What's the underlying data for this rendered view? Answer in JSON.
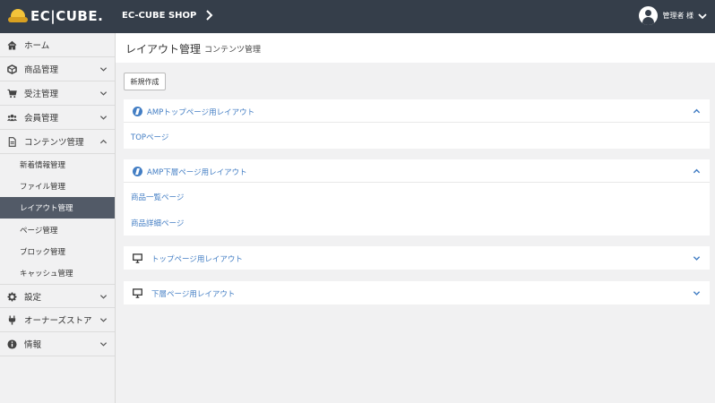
{
  "header": {
    "logo_text": "EC|CUBE.",
    "shop_name": "EC-CUBE SHOP",
    "user_name": "管理者 様"
  },
  "sidebar": {
    "items": [
      {
        "label": "ホーム",
        "icon": "home-icon",
        "expandable": false
      },
      {
        "label": "商品管理",
        "icon": "cube-icon",
        "expandable": true,
        "expanded": false
      },
      {
        "label": "受注管理",
        "icon": "cart-icon",
        "expandable": true,
        "expanded": false
      },
      {
        "label": "会員管理",
        "icon": "users-icon",
        "expandable": true,
        "expanded": false
      },
      {
        "label": "コンテンツ管理",
        "icon": "file-icon",
        "expandable": true,
        "expanded": true
      },
      {
        "label": "設定",
        "icon": "gear-icon",
        "expandable": true,
        "expanded": false
      },
      {
        "label": "オーナーズストア",
        "icon": "plug-icon",
        "expandable": true,
        "expanded": false
      },
      {
        "label": "情報",
        "icon": "info-icon",
        "expandable": true,
        "expanded": false
      }
    ],
    "content_sub_items": [
      {
        "label": "新着情報管理",
        "active": false
      },
      {
        "label": "ファイル管理",
        "active": false
      },
      {
        "label": "レイアウト管理",
        "active": true
      },
      {
        "label": "ページ管理",
        "active": false
      },
      {
        "label": "ブロック管理",
        "active": false
      },
      {
        "label": "キャッシュ管理",
        "active": false
      }
    ]
  },
  "page": {
    "title": "レイアウト管理",
    "subtitle": "コンテンツ管理",
    "new_button": "新規作成"
  },
  "layouts": [
    {
      "title": "AMPトップページ用レイアウト",
      "icon": "bolt-icon",
      "expanded": true,
      "pages": [
        "TOPページ"
      ]
    },
    {
      "title": "AMP下層ページ用レイアウト",
      "icon": "bolt-icon",
      "expanded": true,
      "pages": [
        "商品一覧ページ",
        "商品詳細ページ"
      ]
    },
    {
      "title": "トップページ用レイアウト",
      "icon": "desktop-icon",
      "expanded": false,
      "pages": []
    },
    {
      "title": "下層ページ用レイアウト",
      "icon": "desktop-icon",
      "expanded": false,
      "pages": []
    }
  ],
  "colors": {
    "header_bg": "#353e4a",
    "sidebar_active_bg": "#525a67",
    "link_blue": "#437ec4"
  }
}
